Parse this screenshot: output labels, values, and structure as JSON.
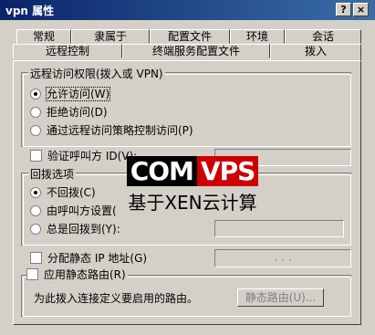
{
  "window": {
    "title": "vpn 属性",
    "help_glyph": "?",
    "close_glyph": "×"
  },
  "tabs": {
    "row1": [
      "常规",
      "隶属于",
      "配置文件",
      "环境",
      "会话"
    ],
    "row2": [
      "远程控制",
      "终端服务配置文件",
      "拨入"
    ],
    "active": "拨入"
  },
  "remote_access": {
    "title": "远程访问权限(拨入或 VPN)",
    "options": [
      "允许访问(W)",
      "拒绝访问(D)",
      "通过远程访问策略控制访问(P)"
    ],
    "selected": "允许访问(W)"
  },
  "verify_caller": {
    "label": "验证呼叫方 ID(V):",
    "value": ""
  },
  "callback": {
    "title": "回拨选项",
    "options": [
      "不回拨(C)",
      "由呼叫方设置(",
      "总是回拨到(Y):"
    ],
    "selected": "不回拨(C)",
    "value": ""
  },
  "static_ip": {
    "label": "分配静态 IP 地址(G)",
    "dots": ".     .     ."
  },
  "static_route": {
    "label": "应用静态路由(R)",
    "description": "为此拨入连接定义要启用的路由。",
    "button": "静态路由(U)..."
  },
  "watermark": {
    "brand_left": "COM",
    "brand_right": "VPS",
    "tagline": "基于XEN云计算"
  },
  "colors": {
    "titlebar_start": "#0a246a",
    "titlebar_end": "#3a6ea5",
    "face": "#d4d0c8",
    "logo_red": "#cc0000"
  }
}
